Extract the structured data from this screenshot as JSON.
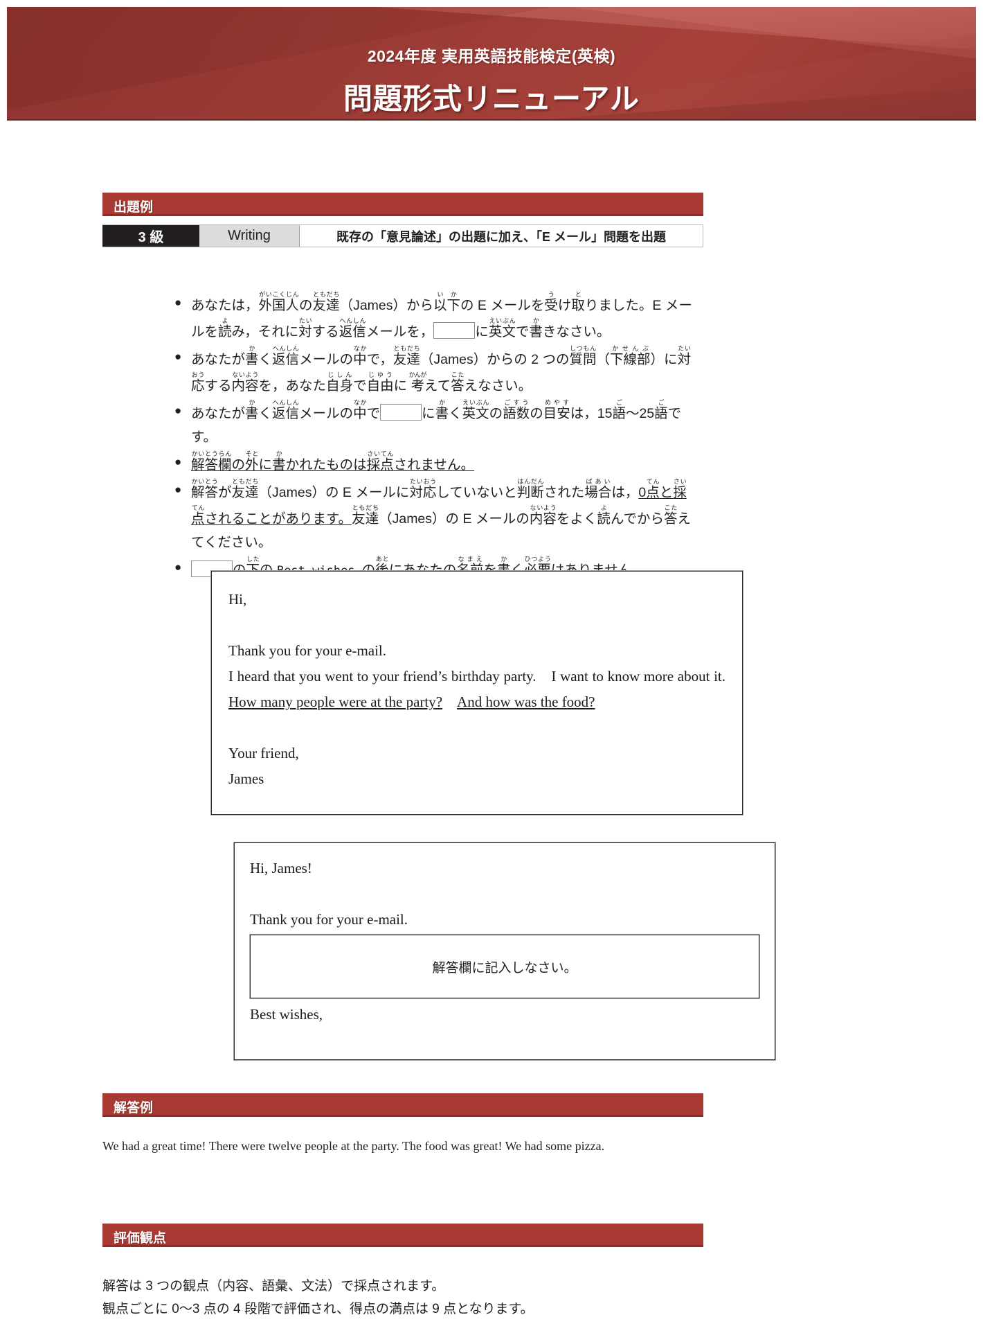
{
  "banner": {
    "subtitle": "2024年度 実用英語技能検定(英検)",
    "title": "問題形式リニューアル",
    "accent_color": "#a93a33",
    "dark_color": "#8d3330"
  },
  "sections": {
    "example_question": "出題例",
    "sample_answer": "解答例",
    "criteria": "評価観点"
  },
  "gradebar": {
    "grade": "3 級",
    "skill": "Writing",
    "description": "既存の「意見論述」の出題に加え、「E メール」問題を出題"
  },
  "instructions": [
    {
      "id": "bullet-1",
      "segments": [
        {
          "t": "あなたは，"
        },
        {
          "t": "外国人",
          "rt": "がいこくじん"
        },
        {
          "t": "の"
        },
        {
          "t": "友達",
          "rt": "ともだち"
        },
        {
          "t": "（James）から"
        },
        {
          "t": "以下",
          "rt": "いか"
        },
        {
          "t": "の E メールを"
        },
        {
          "t": "受",
          "rt": "う"
        },
        {
          "t": "け"
        },
        {
          "t": "取",
          "rt": "と"
        },
        {
          "t": "りました。E メールを"
        },
        {
          "t": "読",
          "rt": "よ"
        },
        {
          "t": "み，それに"
        },
        {
          "t": "対",
          "rt": "たい"
        },
        {
          "t": "する"
        },
        {
          "t": "返信",
          "rt": "へんしん"
        },
        {
          "t": "メールを，"
        },
        {
          "t": "[BLANK]"
        },
        {
          "t": "に"
        },
        {
          "t": "英文",
          "rt": "えいぶん"
        },
        {
          "t": "で"
        },
        {
          "t": "書",
          "rt": "か"
        },
        {
          "t": "きなさい。"
        }
      ],
      "plain": "あなたは，外国人の友達（James）から以下のEメールを受け取りました。Eメールを読み，それに対する返信メールを，□に英文で書きなさい。"
    },
    {
      "id": "bullet-2",
      "plain": "あなたが書く返信メールの中で，友達（James）からの2つの質問（下線部）に対応する内容を，あなた自身で自由に考えて答えなさい。"
    },
    {
      "id": "bullet-3",
      "plain": "あなたが書く返信メールの中で□に書く英文の語数の目安は，15語〜25語です。"
    },
    {
      "id": "bullet-4",
      "plain": "解答欄の外に書かれたものは採点されません。",
      "underline": true
    },
    {
      "id": "bullet-5",
      "plain": "解答が友達（James）のEメールに対応していないと判断された場合は，0点と採点されることがあります。友達（James）のEメールの内容をよく読んでから答えてください。"
    },
    {
      "id": "bullet-6",
      "plain": "□の下のBest wishes,の後にあなたの名前を書く必要はありません。"
    }
  ],
  "incoming_mail": {
    "greeting": "Hi,",
    "line1": "Thank you for your e-mail.",
    "line2": "I heard that you went to your friend’s birthday party.　I want to know more about it.　",
    "question1": "How many people were at the party?",
    "question2": "And how was the food?",
    "closing": "Your friend,",
    "signature": "James"
  },
  "reply_mail": {
    "greeting": "Hi, James!",
    "line1": "Thank you for your e-mail.",
    "answer_placeholder": "解答欄に記入しなさい。",
    "closing": "Best wishes,"
  },
  "sample_answer": {
    "text": "We had a great time! There were twelve people at the party. The food was great! We had some pizza."
  },
  "criteria": {
    "line1": "解答は 3 つの観点（内容、語彙、文法）で採点されます。",
    "line2": "観点ごとに 0〜3 点の 4 段階で評価され、得点の満点は 9 点となります。"
  }
}
